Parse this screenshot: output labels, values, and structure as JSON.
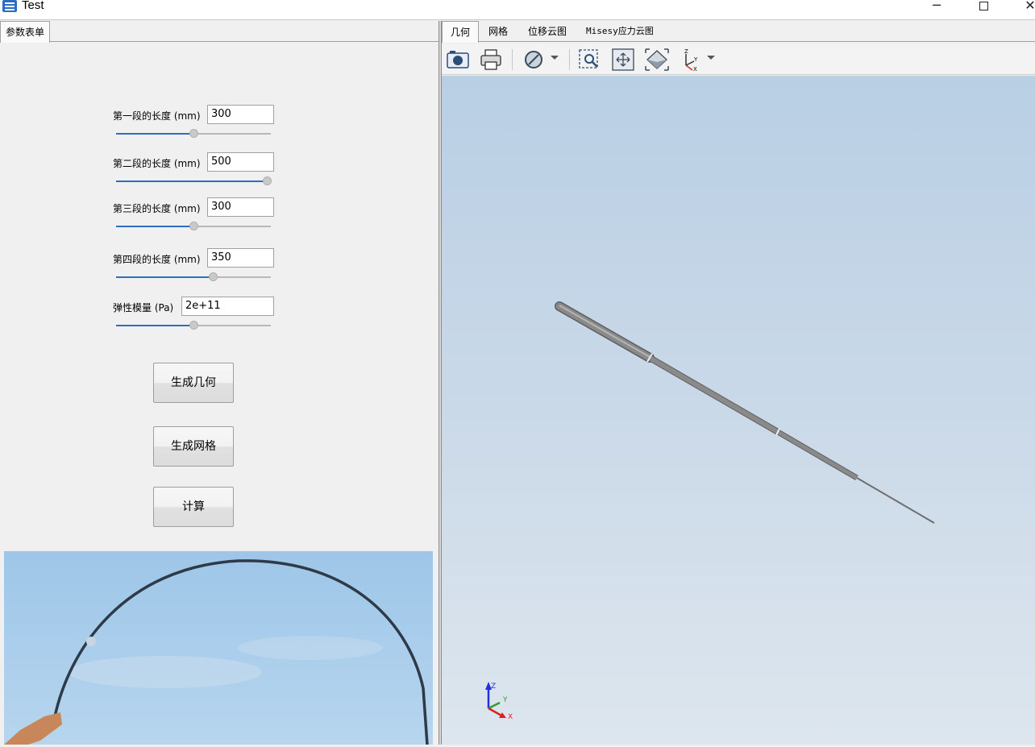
{
  "window": {
    "title": "Test",
    "minimize_glyph": "─",
    "close_glyph": "✕"
  },
  "left_tabs": [
    {
      "label": "参数表单",
      "active": true
    }
  ],
  "params": [
    {
      "label": "第一段的长度 (mm)",
      "value": "300",
      "slider_fraction": 0.5
    },
    {
      "label": "第二段的长度 (mm)",
      "value": "500",
      "slider_fraction": 1.0
    },
    {
      "label": "第三段的长度 (mm)",
      "value": "300",
      "slider_fraction": 0.5
    },
    {
      "label": "第四段的长度 (mm)",
      "value": "350",
      "slider_fraction": 0.63
    },
    {
      "label": "弹性模量 (Pa)",
      "value": "2e+11",
      "slider_fraction": 0.5
    }
  ],
  "actions": {
    "generate_geometry": "生成几何",
    "generate_mesh": "生成网格",
    "compute": "计算"
  },
  "right_tabs": [
    {
      "label": "几何",
      "active": true
    },
    {
      "label": "网格",
      "active": false
    },
    {
      "label": "位移云图",
      "active": false
    },
    {
      "label": "Misesy应力云图",
      "active": false
    }
  ],
  "toolbar": {
    "icons": [
      "camera-icon",
      "print-icon",
      "display-mode-icon",
      "zoom-box-icon",
      "fit-all-icon",
      "view-iso-icon",
      "axes-view-icon"
    ]
  },
  "viewport": {
    "triad_labels": {
      "z": "Z",
      "y": "Y",
      "x": "X"
    },
    "colors": {
      "axis_x": "#e02020",
      "axis_y": "#2aa02a",
      "axis_z": "#2030e0",
      "rod": "#8a8a8a"
    }
  }
}
